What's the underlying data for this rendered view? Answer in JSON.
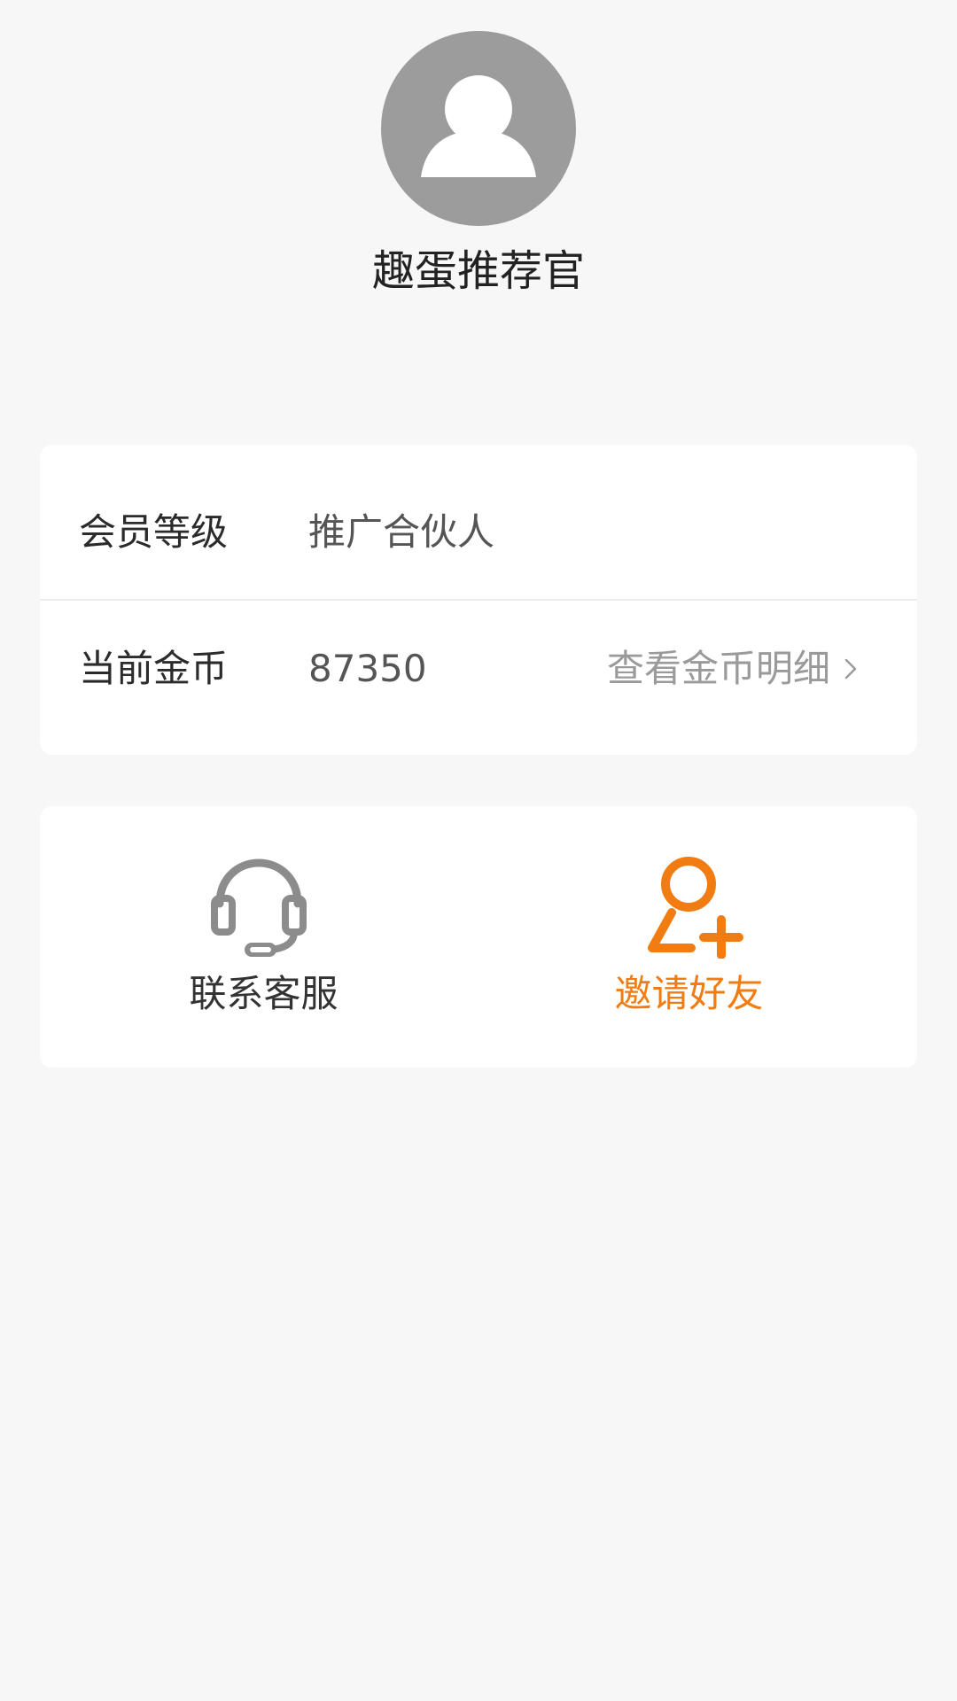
{
  "profile": {
    "username": "趣蛋推荐官",
    "avatar_icon": "user-avatar-icon"
  },
  "info": {
    "level_label": "会员等级",
    "level_value": "推广合伙人",
    "coins_label": "当前金币",
    "coins_value": "87350",
    "coins_detail_link": "查看金币明细"
  },
  "actions": {
    "support_label": "联系客服",
    "support_icon": "headset-icon",
    "invite_label": "邀请好友",
    "invite_icon": "add-friend-icon"
  },
  "colors": {
    "background": "#f7f7f7",
    "card": "#ffffff",
    "accent": "#f07c12",
    "icon_gray": "#8c8c8c",
    "avatar_gray": "#9c9c9c"
  }
}
